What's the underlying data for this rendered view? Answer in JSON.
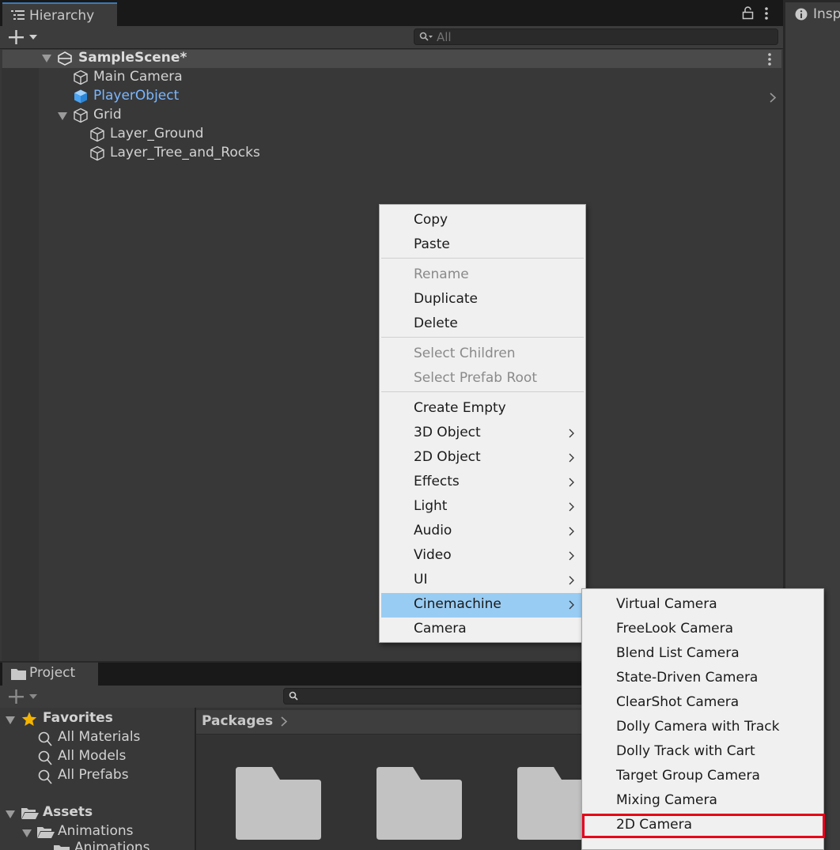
{
  "hierarchy": {
    "tab_label": "Hierarchy",
    "search_placeholder": "All",
    "scene_name": "SampleScene*",
    "items": [
      {
        "label": "Main Camera"
      },
      {
        "label": "PlayerObject"
      },
      {
        "label": "Grid"
      },
      {
        "label": "Layer_Ground"
      },
      {
        "label": "Layer_Tree_and_Rocks"
      }
    ]
  },
  "inspector": {
    "tab_label": "Insp"
  },
  "project": {
    "tab_label": "Project",
    "breadcrumb": "Packages",
    "tree": [
      {
        "label": "Favorites"
      },
      {
        "label": "All Materials"
      },
      {
        "label": "All Models"
      },
      {
        "label": "All Prefabs"
      },
      {
        "label": "Assets"
      },
      {
        "label": "Animations"
      },
      {
        "label": "Animations"
      }
    ]
  },
  "context_menu": {
    "items": [
      {
        "label": "Copy"
      },
      {
        "label": "Paste"
      },
      {
        "label": "Rename"
      },
      {
        "label": "Duplicate"
      },
      {
        "label": "Delete"
      },
      {
        "label": "Select Children"
      },
      {
        "label": "Select Prefab Root"
      },
      {
        "label": "Create Empty"
      },
      {
        "label": "3D Object"
      },
      {
        "label": "2D Object"
      },
      {
        "label": "Effects"
      },
      {
        "label": "Light"
      },
      {
        "label": "Audio"
      },
      {
        "label": "Video"
      },
      {
        "label": "UI"
      },
      {
        "label": "Cinemachine"
      },
      {
        "label": "Camera"
      }
    ]
  },
  "cinemachine_submenu": {
    "items": [
      {
        "label": "Virtual Camera"
      },
      {
        "label": "FreeLook Camera"
      },
      {
        "label": "Blend List Camera"
      },
      {
        "label": "State-Driven Camera"
      },
      {
        "label": "ClearShot Camera"
      },
      {
        "label": "Dolly Camera with Track"
      },
      {
        "label": "Dolly Track with Cart"
      },
      {
        "label": "Target Group Camera"
      },
      {
        "label": "Mixing Camera"
      },
      {
        "label": "2D Camera"
      }
    ]
  },
  "colors": {
    "selected_text": "#7bb7ff",
    "menu_highlight": "#99ccf3",
    "callout_border": "#e6001a",
    "tab_accent": "#3a79bb",
    "favorites_star": "#f4b400"
  }
}
